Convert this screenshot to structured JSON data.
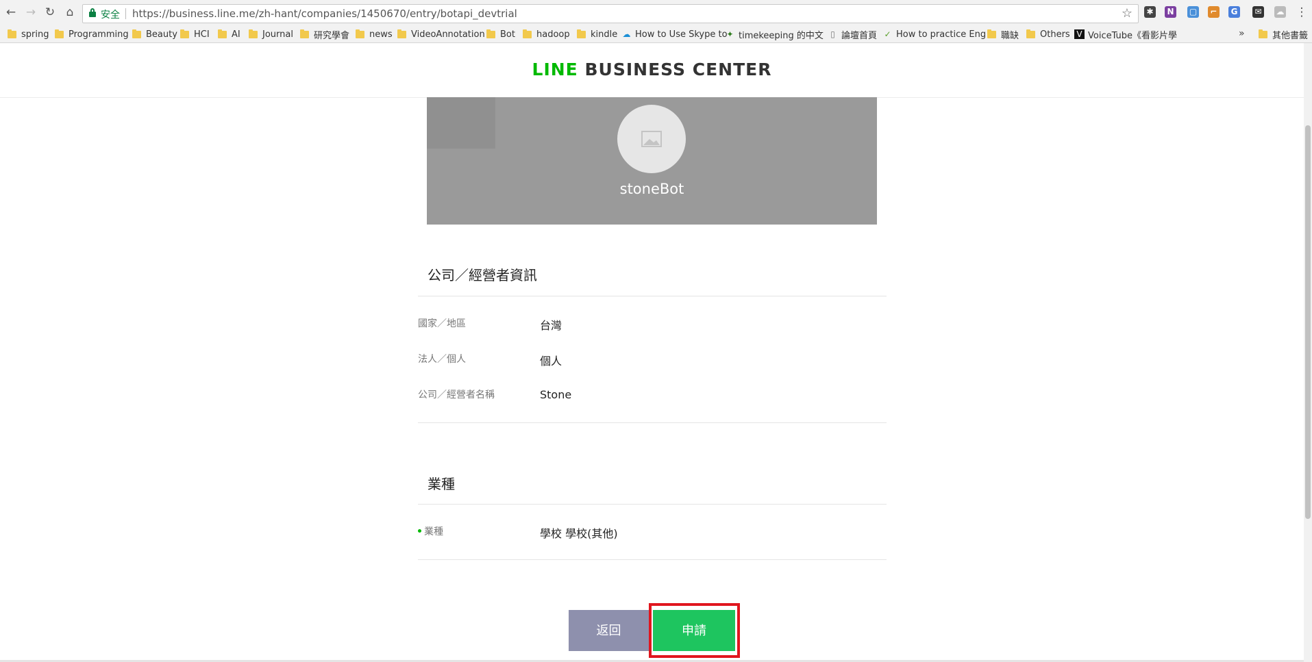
{
  "browser": {
    "secure_label": "安全",
    "url": "https://business.line.me/zh-hant/companies/1450670/entry/botapi_devtrial",
    "bookmarks": [
      {
        "label": "spring",
        "kind": "folder"
      },
      {
        "label": "Programming",
        "kind": "folder"
      },
      {
        "label": "Beauty",
        "kind": "folder"
      },
      {
        "label": "HCI",
        "kind": "folder"
      },
      {
        "label": "AI",
        "kind": "folder"
      },
      {
        "label": "Journal",
        "kind": "folder"
      },
      {
        "label": "研究學會",
        "kind": "folder"
      },
      {
        "label": "news",
        "kind": "folder"
      },
      {
        "label": "VideoAnnotation",
        "kind": "folder"
      },
      {
        "label": "Bot",
        "kind": "folder"
      },
      {
        "label": "hadoop",
        "kind": "folder"
      },
      {
        "label": "kindle",
        "kind": "folder"
      },
      {
        "label": "How to Use Skype to",
        "kind": "link"
      },
      {
        "label": "timekeeping 的中文",
        "kind": "link"
      },
      {
        "label": "論壇首頁",
        "kind": "page"
      },
      {
        "label": "How to practice Eng",
        "kind": "link"
      },
      {
        "label": "職缺",
        "kind": "folder"
      },
      {
        "label": "Others",
        "kind": "folder"
      },
      {
        "label": "VoiceTube《看影片學",
        "kind": "link"
      },
      {
        "label": "其他書籤",
        "kind": "folder"
      }
    ],
    "overflow": "»"
  },
  "header": {
    "logo_line": "LINE",
    "logo_rest": "BUSINESS CENTER"
  },
  "bot": {
    "name": "stoneBot"
  },
  "company_section": {
    "title": "公司／經營者資訊",
    "fields": [
      {
        "label": "國家／地區",
        "value": "台灣"
      },
      {
        "label": "法人／個人",
        "value": "個人"
      },
      {
        "label": "公司／經營者名稱",
        "value": "Stone"
      }
    ]
  },
  "industry_section": {
    "title": "業種",
    "field_label": "業種",
    "field_value": "學校 學校(其他)"
  },
  "actions": {
    "back_label": "返回",
    "apply_label": "申請"
  },
  "colors": {
    "brand_green": "#00b900",
    "apply_green": "#1ec55f",
    "back_purple": "#8e90ad",
    "highlight_red": "#e0161e"
  }
}
